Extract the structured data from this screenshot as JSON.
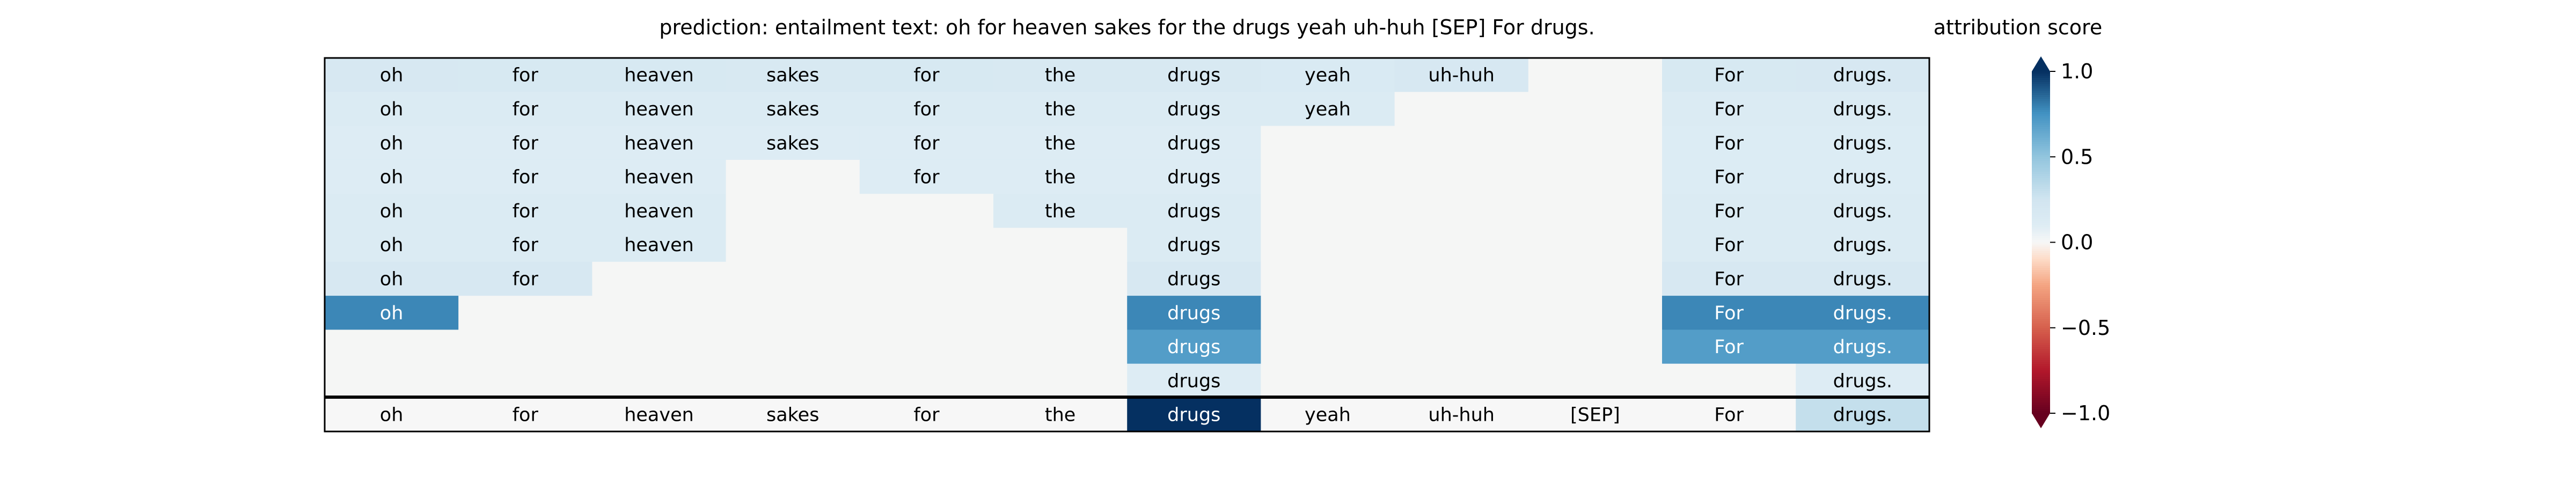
{
  "title": "prediction:  entailment     text:  oh for heaven sakes for the drugs yeah uh-huh [SEP] For drugs.",
  "chart_data": {
    "type": "heatmap",
    "columns": [
      "oh",
      "for",
      "heaven",
      "sakes",
      "for",
      "the",
      "drugs",
      "yeah",
      "uh-huh",
      "[SEP]",
      "For",
      "drugs."
    ],
    "rows": [
      [
        0.18,
        0.17,
        0.17,
        0.16,
        0.17,
        0.16,
        0.16,
        0.15,
        0.18,
        null,
        0.17,
        0.18
      ],
      [
        0.12,
        0.12,
        0.12,
        0.12,
        0.12,
        0.12,
        0.12,
        0.12,
        null,
        null,
        0.13,
        0.13
      ],
      [
        0.1,
        0.1,
        0.1,
        0.1,
        0.1,
        0.1,
        0.1,
        null,
        null,
        null,
        0.11,
        0.11
      ],
      [
        0.1,
        0.1,
        0.1,
        null,
        0.1,
        0.1,
        0.1,
        null,
        null,
        null,
        0.11,
        0.11
      ],
      [
        0.12,
        0.12,
        0.12,
        null,
        null,
        0.12,
        0.12,
        null,
        null,
        null,
        0.12,
        0.12
      ],
      [
        0.12,
        0.12,
        0.12,
        null,
        null,
        null,
        0.12,
        null,
        null,
        null,
        0.12,
        0.12
      ],
      [
        0.18,
        0.18,
        null,
        null,
        null,
        null,
        0.18,
        null,
        null,
        null,
        0.18,
        0.18
      ],
      [
        0.78,
        null,
        null,
        null,
        null,
        null,
        0.78,
        null,
        null,
        null,
        0.78,
        0.78
      ],
      [
        null,
        null,
        null,
        null,
        null,
        null,
        0.7,
        null,
        null,
        null,
        0.7,
        0.7
      ],
      [
        null,
        null,
        null,
        null,
        null,
        null,
        0.1,
        null,
        null,
        null,
        null,
        0.1
      ],
      [
        0.0,
        0.0,
        0.0,
        0.0,
        0.0,
        0.0,
        1.0,
        0.0,
        0.0,
        0.0,
        0.0,
        0.3
      ]
    ],
    "colorbar": {
      "label": "attribution score",
      "range": [
        -1.0,
        1.0
      ],
      "ticks": [
        {
          "value": 1.0,
          "label": "1.0"
        },
        {
          "value": 0.5,
          "label": "0.5"
        },
        {
          "value": 0.0,
          "label": "0.0"
        },
        {
          "value": -0.5,
          "label": "−0.5"
        },
        {
          "value": -1.0,
          "label": "−1.0"
        }
      ],
      "colormap": "RdBu"
    }
  }
}
